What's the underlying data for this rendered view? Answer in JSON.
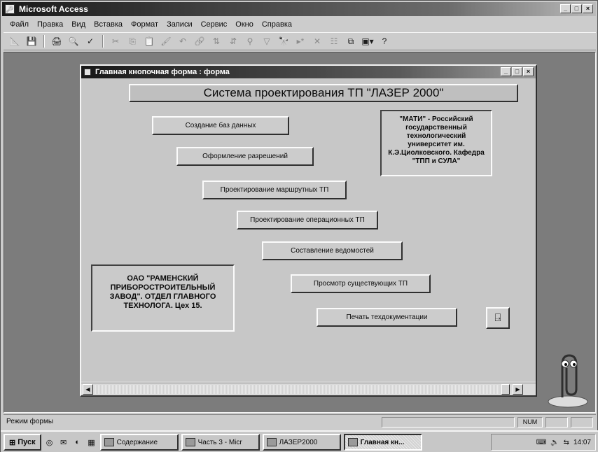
{
  "app": {
    "title": "Microsoft Access",
    "window_controls": [
      "_",
      "□",
      "×"
    ]
  },
  "menu": [
    "Файл",
    "Правка",
    "Вид",
    "Вставка",
    "Формат",
    "Записи",
    "Сервис",
    "Окно",
    "Справка"
  ],
  "toolbar": {
    "icons": [
      "view-icon",
      "save-icon",
      "print-icon",
      "print-preview-icon",
      "spelling-icon",
      "cut-icon",
      "copy-icon",
      "paste-icon",
      "format-painter-icon",
      "undo-icon",
      "insert-hyperlink-icon",
      "sort-ascending-icon",
      "sort-descending-icon",
      "filter-by-selection-icon",
      "apply-filter-icon",
      "find-icon",
      "new-record-icon",
      "delete-record-icon",
      "properties-icon",
      "database-window-icon",
      "new-object-icon",
      "help-icon"
    ]
  },
  "form": {
    "title": "Главная кнопочная форма : форма",
    "header": "Система проектирования ТП \"ЛАЗЕР 2000\"",
    "buttons": [
      {
        "label": "Создание баз данных"
      },
      {
        "label": "Оформление разрешений"
      },
      {
        "label": "Проектирование маршрутных ТП"
      },
      {
        "label": "Проектирование операционных ТП"
      },
      {
        "label": "Составление ведомостей"
      },
      {
        "label": "Просмотр существующих ТП"
      },
      {
        "label": "Печать техдокументации"
      }
    ],
    "mati_lines": [
      "\"МАТИ\" - Российский",
      "государственный",
      "технологический",
      "университет им.",
      "К.Э.Циолковского. Кафедра",
      "\"ТПП и СУЛА\""
    ],
    "ramensky_lines": [
      "ОАО \"РАМЕНСКИЙ",
      "ПРИБОРОСТРОИТЕЛЬНЫЙ",
      "ЗАВОД\". ОТДЕЛ ГЛАВНОГО",
      "ТЕХНОЛОГА. Цех 15."
    ]
  },
  "status": {
    "mode": "Режим формы",
    "num": "NUM"
  },
  "taskbar": {
    "start": "Пуск",
    "tasks": [
      {
        "label": "Содержание"
      },
      {
        "label": "Часть 3 - Micr"
      },
      {
        "label": "ЛАЗЕР2000"
      },
      {
        "label": "Главная кн..."
      }
    ],
    "clock": "14:07"
  }
}
